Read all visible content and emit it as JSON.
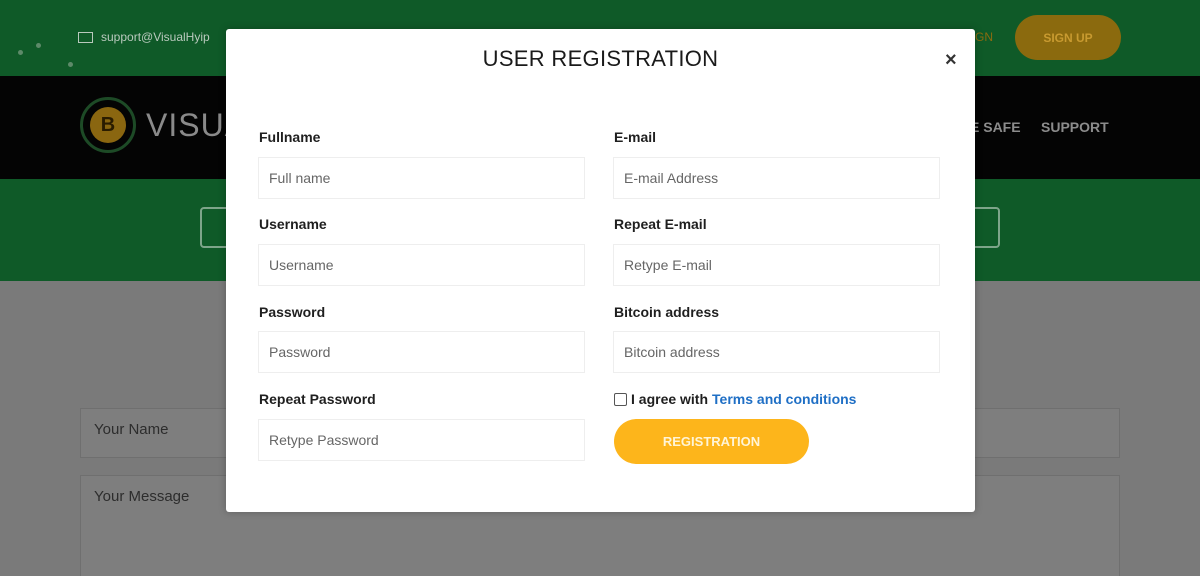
{
  "topbar": {
    "email": "support@VisualHyip",
    "signin_label": "GN",
    "signup_label": "SIGN UP"
  },
  "navbar": {
    "logo_text": "VISUA",
    "logo_symbol": "B",
    "links": [
      "E SAFE",
      "SUPPORT"
    ]
  },
  "contact_form": {
    "name_placeholder": "Your Name",
    "message_placeholder": "Your Message"
  },
  "modal": {
    "title": "USER REGISTRATION",
    "close_symbol": "×",
    "fields": {
      "fullname": {
        "label": "Fullname",
        "placeholder": "Full name"
      },
      "email": {
        "label": "E-mail",
        "placeholder": "E-mail Address"
      },
      "username": {
        "label": "Username",
        "placeholder": "Username"
      },
      "repeat_email": {
        "label": "Repeat E-mail",
        "placeholder": "Retype E-mail"
      },
      "password": {
        "label": "Password",
        "placeholder": "Password"
      },
      "bitcoin": {
        "label": "Bitcoin address",
        "placeholder": "Bitcoin address"
      },
      "repeat_password": {
        "label": "Repeat Password",
        "placeholder": "Retype Password"
      }
    },
    "agree_text": "I agree with",
    "terms_link": "Terms and conditions",
    "submit_label": "REGISTRATION"
  },
  "colors": {
    "green": "#0f5a28",
    "accent": "#fdb51b",
    "link": "#1f6fc5"
  }
}
